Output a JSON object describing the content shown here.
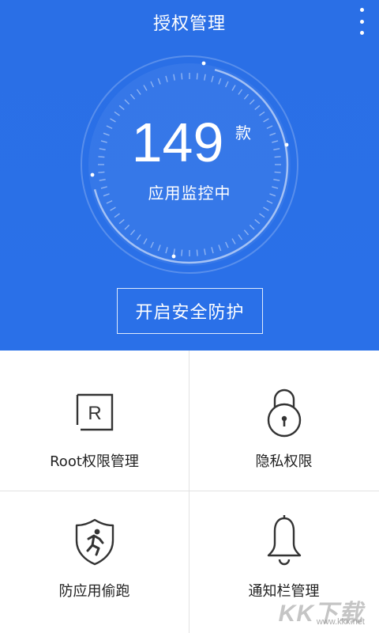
{
  "header": {
    "title": "授权管理",
    "count": "149",
    "count_unit": "款",
    "status": "应用监控中",
    "protect_button": "开启安全防护"
  },
  "tiles": [
    {
      "label": "Root权限管理",
      "icon": "root-r-icon"
    },
    {
      "label": "隐私权限",
      "icon": "lock-icon"
    },
    {
      "label": "防应用偷跑",
      "icon": "shield-runner-icon"
    },
    {
      "label": "通知栏管理",
      "icon": "bell-icon"
    }
  ],
  "watermark": {
    "brand": "KK下载",
    "url": "www.kkx.net"
  },
  "colors": {
    "header_bg": "#2a70e8",
    "divider": "#e2e2e2",
    "text_dark": "#222222"
  }
}
